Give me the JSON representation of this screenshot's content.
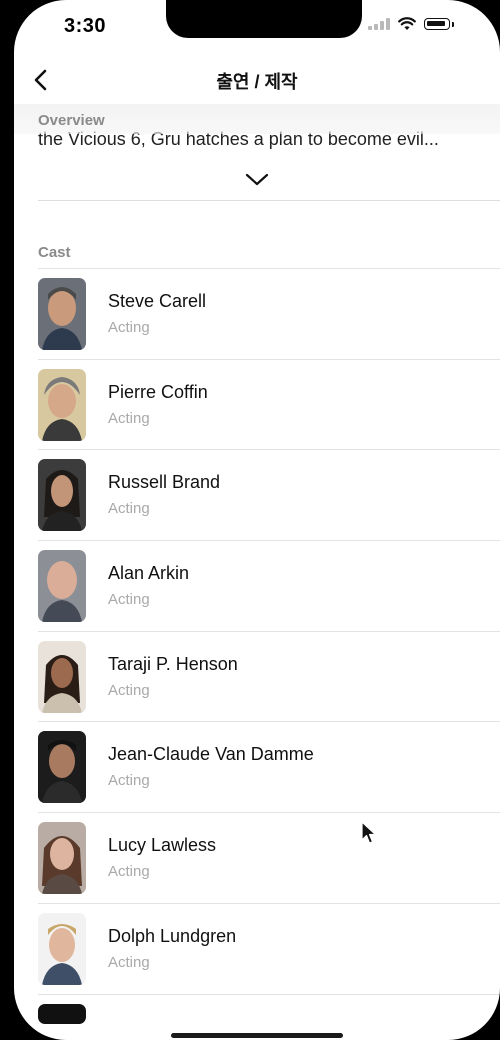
{
  "status_bar": {
    "time": "3:30"
  },
  "nav": {
    "title": "출연 / 제작"
  },
  "overview": {
    "label": "Overview",
    "text": "the Vicious 6, Gru hatches a plan to become evil..."
  },
  "cast": {
    "label": "Cast",
    "items": [
      {
        "name": "Steve Carell",
        "role": "Acting"
      },
      {
        "name": "Pierre Coffin",
        "role": "Acting"
      },
      {
        "name": "Russell Brand",
        "role": "Acting"
      },
      {
        "name": "Alan Arkin",
        "role": "Acting"
      },
      {
        "name": "Taraji P. Henson",
        "role": "Acting"
      },
      {
        "name": "Jean-Claude Van Damme",
        "role": "Acting"
      },
      {
        "name": "Lucy Lawless",
        "role": "Acting"
      },
      {
        "name": "Dolph Lundgren",
        "role": "Acting"
      }
    ]
  }
}
